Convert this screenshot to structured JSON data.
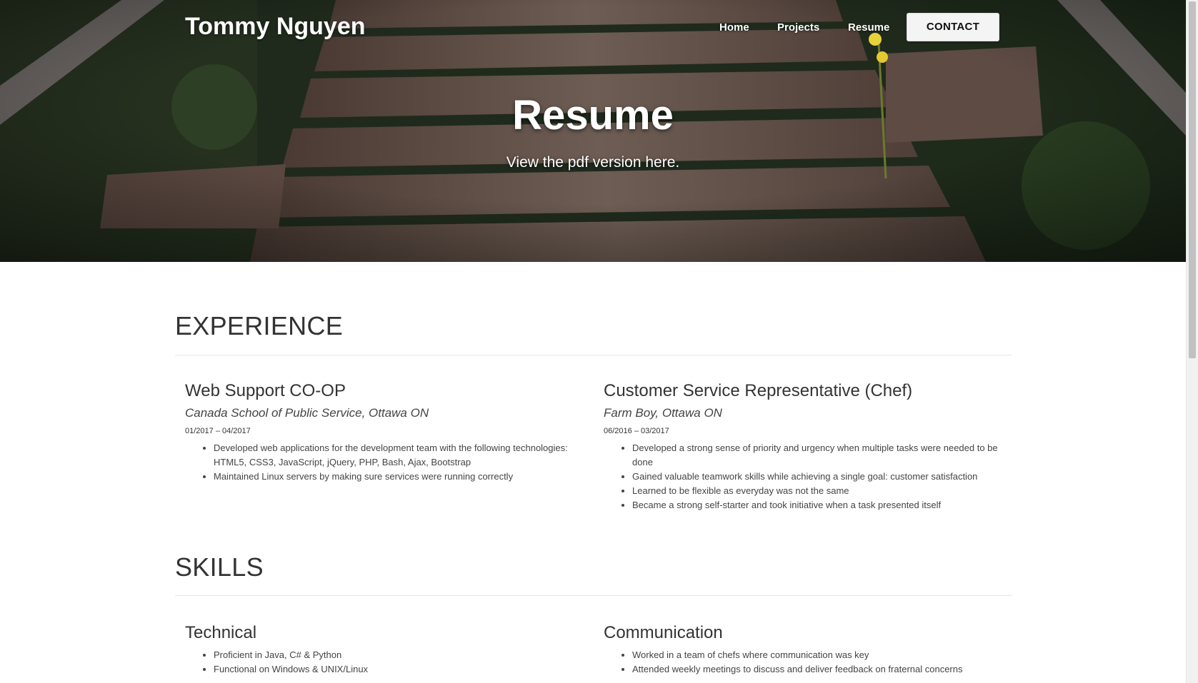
{
  "header": {
    "brand": "Tommy Nguyen",
    "nav": [
      {
        "label": "Home"
      },
      {
        "label": "Projects"
      },
      {
        "label": "Resume"
      }
    ],
    "contact_label": "CONTACT"
  },
  "hero": {
    "title": "Resume",
    "subtitle": "View the pdf version here."
  },
  "experience": {
    "heading": "EXPERIENCE",
    "jobs": [
      {
        "title": "Web Support CO-OP",
        "company": "Canada School of Public Service, Ottawa ON",
        "dates": "01/2017 – 04/2017",
        "bullets": [
          "Developed web applications for the development team with the following technologies: HTML5, CSS3, JavaScript, jQuery, PHP, Bash, Ajax, Bootstrap",
          "Maintained Linux servers by making sure services were running correctly"
        ]
      },
      {
        "title": "Customer Service Representative (Chef)",
        "company": "Farm Boy, Ottawa ON",
        "dates": "06/2016 – 03/2017",
        "bullets": [
          "Developed a strong sense of priority and urgency when multiple tasks were needed to be done",
          "Gained valuable teamwork skills while achieving a single goal: customer satisfaction",
          "Learned to be flexible as everyday was not the same",
          "Became a strong self-starter and took initiative when a task presented itself"
        ]
      }
    ]
  },
  "skills": {
    "heading": "SKILLS",
    "groups": [
      {
        "title": "Technical",
        "bullets": [
          "Proficient in Java, C# & Python",
          "Functional on Windows & UNIX/Linux"
        ]
      },
      {
        "title": "Communication",
        "bullets": [
          "Worked in a team of chefs where communication was key",
          "Attended weekly meetings to discuss and deliver feedback on fraternal concerns"
        ]
      }
    ]
  }
}
